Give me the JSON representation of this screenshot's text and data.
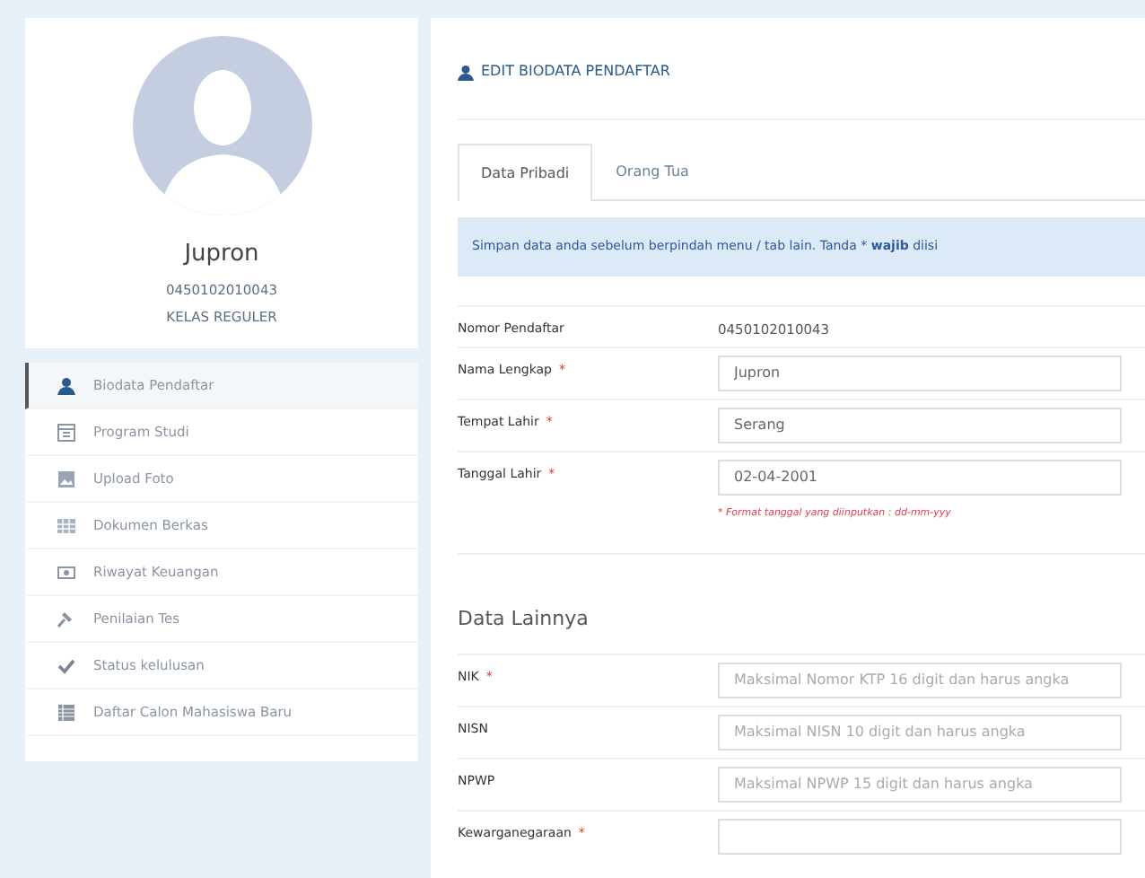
{
  "profile": {
    "name": "Jupron",
    "number": "0450102010043",
    "class": "KELAS REGULER"
  },
  "menu": [
    {
      "label": "Biodata Pendaftar",
      "selected": true
    },
    {
      "label": "Program Studi",
      "selected": false
    },
    {
      "label": "Upload Foto",
      "selected": false
    },
    {
      "label": "Dokumen Berkas",
      "selected": false
    },
    {
      "label": "Riwayat Keuangan",
      "selected": false
    },
    {
      "label": "Penilaian Tes",
      "selected": false
    },
    {
      "label": "Status kelulusan",
      "selected": false
    },
    {
      "label": "Daftar Calon Mahasiswa Baru",
      "selected": false
    }
  ],
  "panel_title": "EDIT BIODATA PENDAFTAR",
  "tabs": [
    {
      "label": "Data Pribadi",
      "selected": true
    },
    {
      "label": "Orang Tua",
      "selected": false
    }
  ],
  "alert": "Simpan data anda sebelum berpindah menu / tab lain. Tanda * **wajib** diisi",
  "fields": [
    {
      "kind": "static",
      "label": "Nomor Pendaftar",
      "value": "0450102010043"
    },
    {
      "kind": "input",
      "label": "Nama Lengkap",
      "required_mark": "*",
      "value": "Jupron"
    },
    {
      "kind": "input",
      "label": "Tempat Lahir",
      "required_mark": "*",
      "value": "Serang"
    },
    {
      "kind": "input",
      "label": "Tanggal Lahir",
      "required_mark": "*",
      "value": "02-04-2001",
      "hint": "* Format tanggal yang diinputkan : dd-mm-yyy"
    }
  ],
  "section_title": "Data Lainnya",
  "other_fields": [
    {
      "kind": "input",
      "label": "NIK",
      "required_mark": "*",
      "placeholder": "Maksimal Nomor KTP 16 digit dan harus angka"
    },
    {
      "kind": "input",
      "label": "NISN",
      "placeholder": "Maksimal NISN 10 digit dan harus angka"
    },
    {
      "kind": "input",
      "label": "NPWP",
      "placeholder": "Maksimal NPWP 15 digit dan harus angka"
    },
    {
      "kind": "input",
      "label": "Kewarganegaraan",
      "required_mark": "*"
    }
  ]
}
